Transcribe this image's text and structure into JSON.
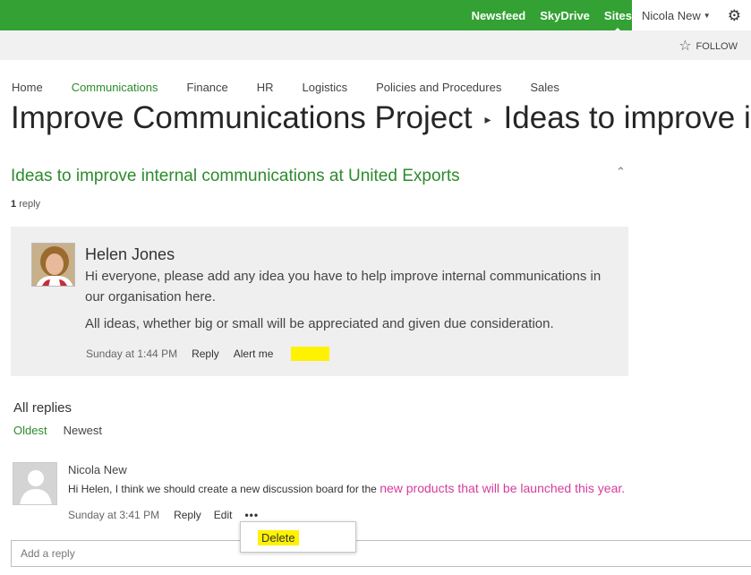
{
  "topbar": {
    "links": [
      "Newsfeed",
      "SkyDrive",
      "Sites"
    ],
    "active_link": "Sites",
    "user_name": "Nicola New",
    "brand_color": "#33a133"
  },
  "subbar": {
    "follow_label": "FOLLOW"
  },
  "nav": {
    "items": [
      "Home",
      "Communications",
      "Finance",
      "HR",
      "Logistics",
      "Policies and Procedures",
      "Sales"
    ],
    "selected": "Communications"
  },
  "page": {
    "title_site": "Improve Communications Project",
    "title_page": "Ideas to improve internal communications at United Exports"
  },
  "discussion": {
    "title": "Ideas to improve internal communications at United Exports",
    "reply_count": "1",
    "reply_label": "reply",
    "post": {
      "author": "Helen Jones",
      "paragraph1": "Hi everyone, please add any idea you have to help improve internal communications in our organisation here.",
      "paragraph2": "All ideas, whether big or small will be appreciated and given due consideration.",
      "time": "Sunday at 1:44 PM",
      "reply_action": "Reply",
      "alert_action": "Alert me"
    }
  },
  "replies": {
    "heading": "All replies",
    "sort_oldest": "Oldest",
    "sort_newest": "Newest",
    "items": [
      {
        "author": "Nicola New",
        "text": "Hi Helen, I think we should create a new discussion board for the",
        "highlight_text": "new products that will be launched this year.",
        "time": "Sunday at 3:41 PM",
        "reply_action": "Reply",
        "edit_action": "Edit",
        "more_action": "•••"
      }
    ]
  },
  "context_menu": {
    "delete_label": "Delete"
  },
  "add_reply": {
    "placeholder": "Add a reply"
  }
}
